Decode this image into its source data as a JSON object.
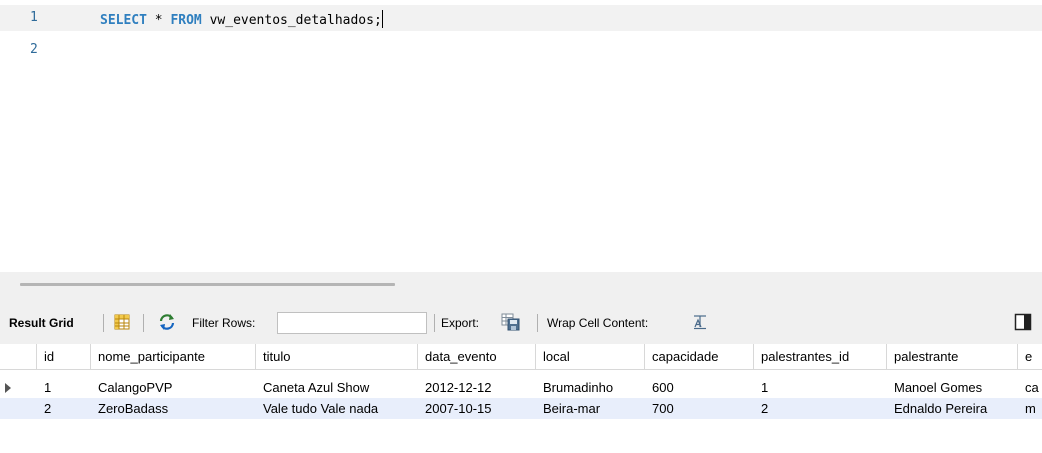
{
  "editor": {
    "lines": [
      {
        "number": "1",
        "keyword1": "SELECT",
        "op": " * ",
        "keyword2": "FROM",
        "rest": " vw_eventos_detalhados;"
      },
      {
        "number": "2"
      }
    ]
  },
  "toolbar": {
    "result_grid_label": "Result Grid",
    "filter_rows_label": "Filter Rows:",
    "filter_rows_value": "",
    "export_label": "Export:",
    "wrap_cell_label": "Wrap Cell Content:"
  },
  "grid": {
    "columns": [
      "id",
      "nome_participante",
      "titulo",
      "data_evento",
      "local",
      "capacidade",
      "palestrantes_id",
      "palestrante",
      "e"
    ],
    "rows": [
      [
        "1",
        "CalangoPVP",
        "Caneta Azul Show",
        "2012-12-12",
        "Brumadinho",
        "600",
        "1",
        "Manoel Gomes",
        "ca"
      ],
      [
        "2",
        "ZeroBadass",
        "Vale tudo Vale nada",
        "2007-10-15",
        "Beira-mar",
        "700",
        "2",
        "Ednaldo Pereira",
        "m"
      ]
    ]
  },
  "icons": {
    "grid_view": "grid-view-icon",
    "refresh": "refresh-icon",
    "export": "export-icon",
    "wrap": "wrap-icon",
    "panel_toggle": "panel-toggle-icon",
    "row_pointer": "row-pointer-icon"
  },
  "colors": {
    "keyword": "#2f7fbf",
    "line_number": "#2f6b9a",
    "current_line": "#f2f2f2",
    "toolbar_bg": "#f0f0f0",
    "selected_row": "#e8eefb"
  }
}
